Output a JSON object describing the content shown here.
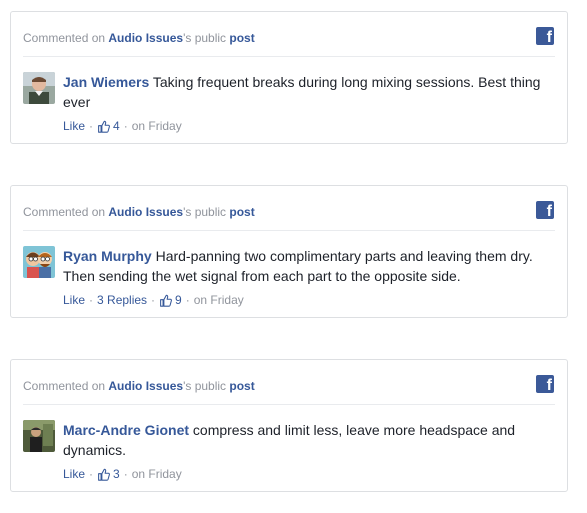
{
  "fb_glyph": "f",
  "posts": [
    {
      "header": {
        "prefix": "Commented on ",
        "page": "Audio Issues",
        "mid": "'s public ",
        "post": "post"
      },
      "author": "Jan Wiemers",
      "text": "Taking frequent breaks during long mixing sessions. Best thing ever",
      "like_label": "Like",
      "replies": "",
      "likes": "4",
      "time": "on Friday"
    },
    {
      "header": {
        "prefix": "Commented on ",
        "page": "Audio Issues",
        "mid": "'s public ",
        "post": "post"
      },
      "author": "Ryan Murphy",
      "text": "Hard-panning two complimentary parts and leaving them dry. Then sending the wet signal from each part to the opposite side.",
      "like_label": "Like",
      "replies": "3 Replies",
      "likes": "9",
      "time": "on Friday"
    },
    {
      "header": {
        "prefix": "Commented on ",
        "page": "Audio Issues",
        "mid": "'s public ",
        "post": "post"
      },
      "author": "Marc-Andre Gionet",
      "text": "compress and limit less, leave more headspace and dynamics.",
      "like_label": "Like",
      "replies": "",
      "likes": "3",
      "time": "on Friday"
    }
  ]
}
